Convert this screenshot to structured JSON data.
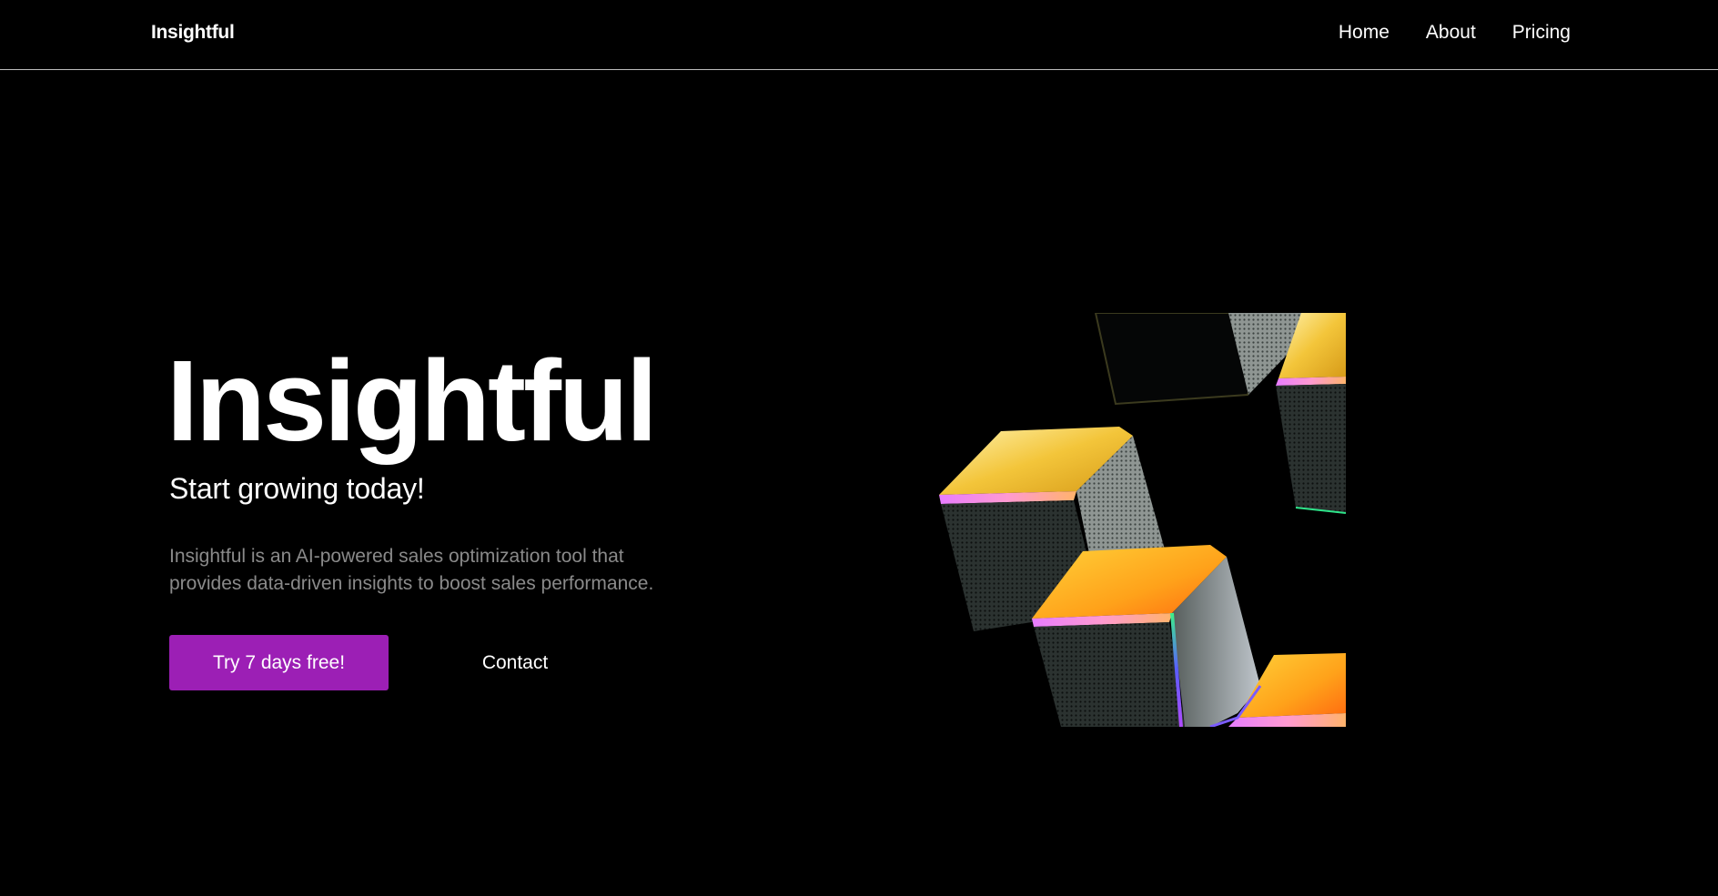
{
  "header": {
    "brand": "Insightful",
    "nav": [
      {
        "label": "Home"
      },
      {
        "label": "About"
      },
      {
        "label": "Pricing"
      }
    ]
  },
  "hero": {
    "title": "Insightful",
    "subtitle": "Start growing today!",
    "description": "Insightful is an AI-powered sales optimization tool that provides data-driven insights to boost sales performance.",
    "primary_cta": "Try 7 days free!",
    "secondary_cta": "Contact"
  },
  "colors": {
    "background": "#000000",
    "accent": "#9c1fb5",
    "text_muted": "#8a8a8a",
    "divider": "#bdbdbd"
  },
  "icons": {
    "hero_image": "abstract-3d-cubes-illustration"
  }
}
